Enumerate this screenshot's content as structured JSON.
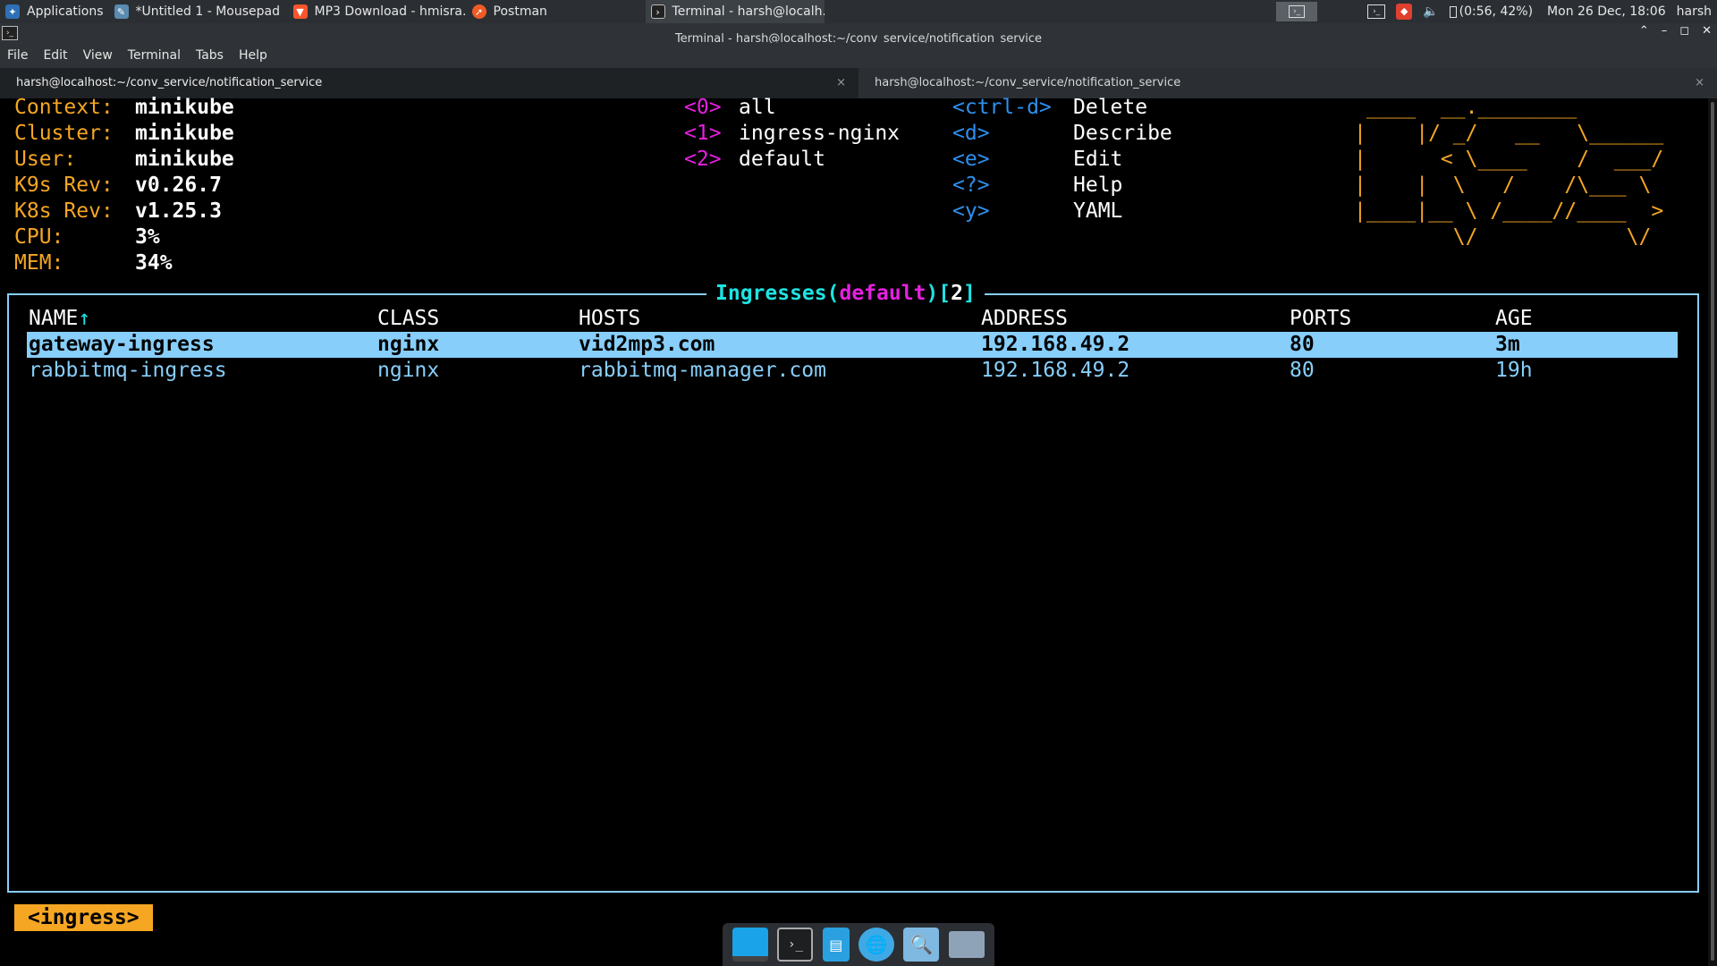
{
  "topbar": {
    "applications_label": "Applications",
    "tasks": [
      {
        "label": "*Untitled 1 - Mousepad",
        "icon": "text-editor-icon"
      },
      {
        "label": "MP3 Download - hmisra...",
        "icon": "brave-browser-icon"
      },
      {
        "label": "Postman",
        "icon": "postman-icon"
      },
      {
        "label": "Terminal - harsh@localh...",
        "icon": "terminal-icon"
      }
    ],
    "battery": "(0:56, 42%)",
    "clock": "Mon 26 Dec, 18:06",
    "user": "harsh"
  },
  "window": {
    "title": "Terminal - harsh@localhost:~/conv_service/notification_service"
  },
  "menubar": [
    "File",
    "Edit",
    "View",
    "Terminal",
    "Tabs",
    "Help"
  ],
  "tabs": [
    {
      "label": "harsh@localhost:~/conv_service/notification_service",
      "close": "×"
    },
    {
      "label": "harsh@localhost:~/conv_service/notification_service",
      "close": "×"
    }
  ],
  "k9s": {
    "info": [
      {
        "key": "Context:",
        "value": "minikube"
      },
      {
        "key": "Cluster:",
        "value": "minikube"
      },
      {
        "key": "User:",
        "value": "minikube"
      },
      {
        "key": "K9s Rev:",
        "value": "v0.26.7"
      },
      {
        "key": "K8s Rev:",
        "value": "v1.25.3"
      },
      {
        "key": "CPU:",
        "value": "3%"
      },
      {
        "key": "MEM:",
        "value": "34%"
      }
    ],
    "namespaces": [
      {
        "key": "<0>",
        "label": "all"
      },
      {
        "key": "<1>",
        "label": "ingress-nginx"
      },
      {
        "key": "<2>",
        "label": "default"
      }
    ],
    "hotkeys": [
      {
        "key": "<ctrl-d>",
        "label": "Delete"
      },
      {
        "key": "<d>",
        "label": "Describe"
      },
      {
        "key": "<e>",
        "label": "Edit"
      },
      {
        "key": "<?>",
        "label": "Help"
      },
      {
        "key": "<y>",
        "label": "YAML"
      }
    ],
    "logo": " ____  __.________\n|    |/ _/   __   \\______\n|      < \\____    /  ___/\n|    |  \\   /    /\\___ \\\n|____|__ \\ /____//____  >\n        \\/            \\/",
    "panel": {
      "title_resource": "Ingresses",
      "title_namespace": "default",
      "title_count": "2"
    },
    "table": {
      "headers": [
        "NAME",
        "CLASS",
        "HOSTS",
        "ADDRESS",
        "PORTS",
        "AGE"
      ],
      "sort_arrow": "↑",
      "rows": [
        [
          "gateway-ingress",
          "nginx",
          "vid2mp3.com",
          "192.168.49.2",
          "80",
          "3m"
        ],
        [
          "rabbitmq-ingress",
          "nginx",
          "rabbitmq-manager.com",
          "192.168.49.2",
          "80",
          "19h"
        ]
      ]
    },
    "crumb": "<ingress>"
  },
  "dock": [
    "show-desktop-icon",
    "terminal-icon",
    "file-manager-icon",
    "web-browser-icon",
    "app-finder-icon",
    "folder-icon"
  ],
  "colors": {
    "accent_orange": "#f5a623",
    "selection": "#87cefa",
    "magenta": "#e520e0",
    "key_blue": "#2e90f0",
    "title_cyan": "#1ee3e3"
  }
}
